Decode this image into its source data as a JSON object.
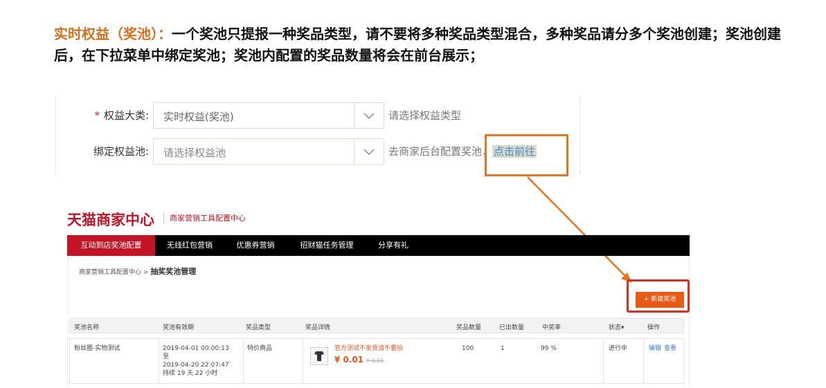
{
  "heading": {
    "highlight": "实时权益（奖池）：",
    "text": "一个奖池只提报一种奖品类型，请不要将多种奖品类型混合，多种奖品请分多个奖池创建；奖池创建后，在下拉菜单中绑定奖池；奖池内配置的奖品数量将会在前台展示；"
  },
  "form": {
    "row1": {
      "required_mark": "*",
      "label": "权益大类:",
      "value": "实时权益(奖池)",
      "hint": "请选择权益类型"
    },
    "row2": {
      "label": "绑定权益池:",
      "placeholder": "请选择权益池",
      "hint": "去商家后台配置奖池，",
      "link": "点击前往"
    }
  },
  "tmall": {
    "brand": "天猫商家中心",
    "subtitle": "商家营销工具配置中心",
    "tabs": [
      "互动到店奖池配置",
      "无线红包营销",
      "优惠券营销",
      "招财猫任务管理",
      "分享有礼"
    ],
    "breadcrumb": {
      "parent": "商家营销工具配置中心",
      "sep": ">",
      "current": "抽奖奖池管理"
    },
    "new_button": "+ 新建奖池",
    "columns": [
      "奖池名称",
      "奖池有效期",
      "奖品类型",
      "奖品详情",
      "奖品数量",
      "已出数量",
      "中奖率",
      "状态▾",
      "操作"
    ],
    "row": {
      "name": "粉丝圈-实物测试",
      "validity_start": "2019-04-01 00:00:13",
      "validity_to": "至",
      "validity_end": "2019-04-20 22:07:47",
      "duration": "持续 19 天 22 小时",
      "prize_type": "特价商品",
      "prize_name": "官方测试不发货请不要拍",
      "price": "¥ 0.01",
      "old_price": "¥ 0.01",
      "quantity": "100",
      "issued": "1",
      "rate": "99 %",
      "status": "进行中",
      "action_edit": "编辑",
      "action_view": "查看"
    }
  },
  "colors": {
    "accent_orange": "#e8731f",
    "tmall_red": "#c21425",
    "link_blue": "#3d8fd6"
  }
}
